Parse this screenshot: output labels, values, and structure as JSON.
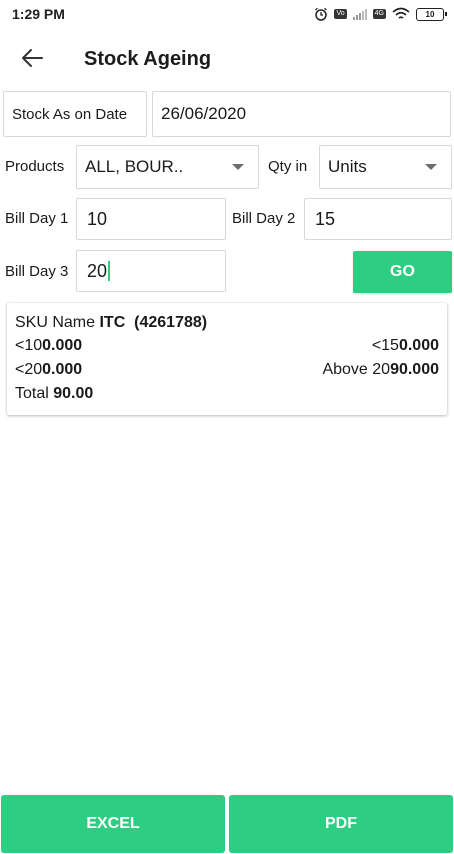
{
  "status_bar": {
    "time": "1:29 PM",
    "battery": "10",
    "icons": [
      "alarm-icon",
      "volte-icon",
      "signal-icon",
      "4g-icon",
      "wifi-icon",
      "battery-icon"
    ]
  },
  "header": {
    "title": "Stock Ageing"
  },
  "form": {
    "stock_date_label": "Stock As on Date",
    "stock_date_value": "26/06/2020",
    "products_label": "Products",
    "products_value": "ALL, BOUR..",
    "qty_label": "Qty in",
    "qty_value": "Units",
    "bill_day1_label": "Bill Day 1",
    "bill_day1_value": "10",
    "bill_day2_label": "Bill Day 2",
    "bill_day2_value": "15",
    "bill_day3_label": "Bill Day 3",
    "bill_day3_value": "20",
    "go_label": "GO"
  },
  "result": {
    "sku_label": "SKU Name",
    "sku_value": "ITC  (4261788)",
    "b1_label": "<10",
    "b1_value": "0.000",
    "b2_label": "<15",
    "b2_value": "0.000",
    "b3_label": "<20",
    "b3_value": "0.000",
    "b4_label": "Above 20",
    "b4_value": "90.000",
    "total_label": "Total",
    "total_value": "90.00"
  },
  "footer": {
    "excel_label": "EXCEL",
    "pdf_label": "PDF"
  },
  "colors": {
    "accent": "#2dcd82",
    "caret": "#2ecf83"
  }
}
